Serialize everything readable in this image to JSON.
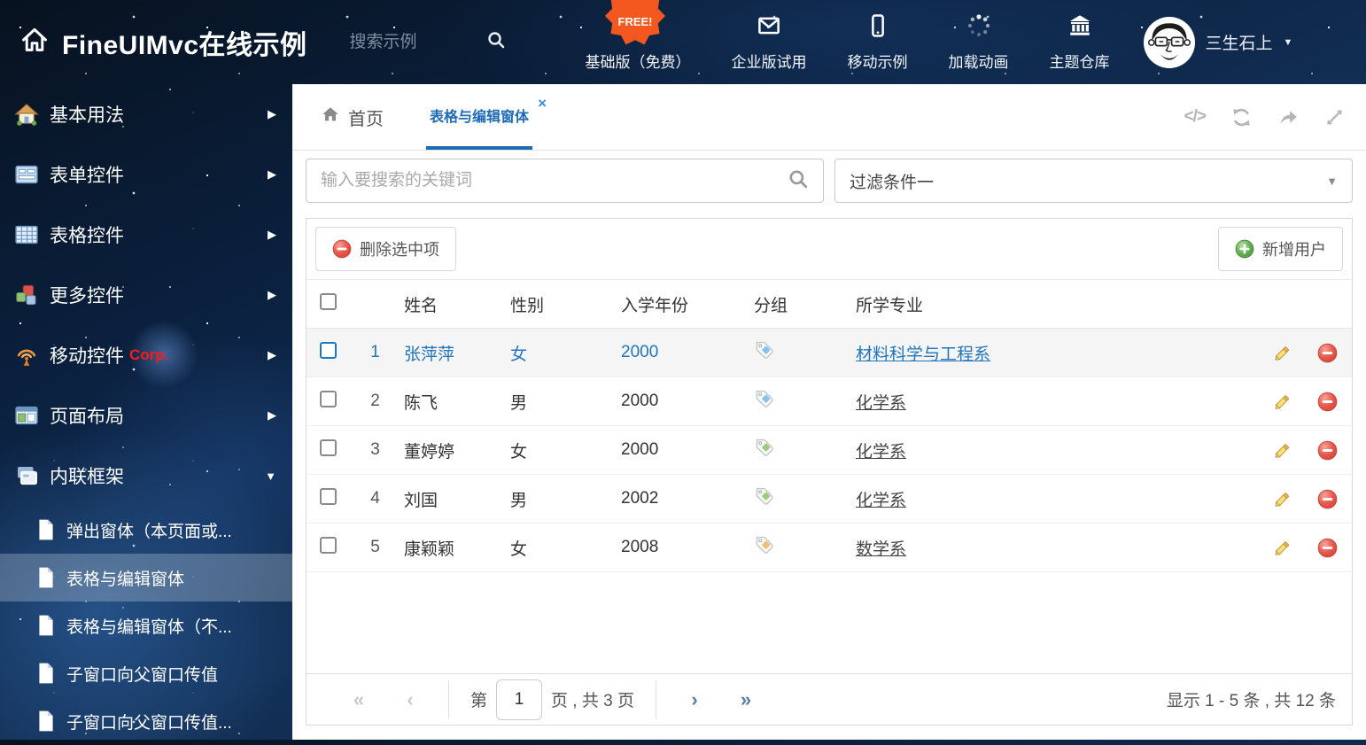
{
  "header": {
    "title": "FineUIMvc在线示例",
    "search_placeholder": "搜索示例",
    "free_badge": "FREE!",
    "nav": [
      {
        "label": "基础版（免费）",
        "icon": "download-icon"
      },
      {
        "label": "企业版试用",
        "icon": "envelope-icon"
      },
      {
        "label": "移动示例",
        "icon": "mobile-icon"
      },
      {
        "label": "加载动画",
        "icon": "spinner-icon"
      },
      {
        "label": "主题仓库",
        "icon": "bank-icon"
      }
    ],
    "user_name": "三生石上"
  },
  "sidebar": {
    "items": [
      {
        "label": "基本用法",
        "icon": "home-icon"
      },
      {
        "label": "表单控件",
        "icon": "form-icon"
      },
      {
        "label": "表格控件",
        "icon": "grid-icon"
      },
      {
        "label": "更多控件",
        "icon": "cubes-icon"
      },
      {
        "label": "移动控件",
        "icon": "antenna-icon",
        "badge": "Corp."
      },
      {
        "label": "页面布局",
        "icon": "layout-icon"
      },
      {
        "label": "内联框架",
        "icon": "frames-icon",
        "expanded": true
      }
    ],
    "subitems": [
      {
        "label": "弹出窗体（本页面或..."
      },
      {
        "label": "表格与编辑窗体",
        "selected": true
      },
      {
        "label": "表格与编辑窗体（不..."
      },
      {
        "label": "子窗口向父窗口传值"
      },
      {
        "label": "子窗口向父窗口传值..."
      }
    ]
  },
  "tabs": [
    {
      "label": "首页",
      "icon": "home-icon"
    },
    {
      "label": "表格与编辑窗体",
      "active": true,
      "closable": true
    }
  ],
  "filters": {
    "search_placeholder": "输入要搜索的关键词",
    "filter_value": "过滤条件一"
  },
  "toolbar": {
    "delete_label": "删除选中项",
    "add_label": "新增用户"
  },
  "table": {
    "columns": [
      "姓名",
      "性别",
      "入学年份",
      "分组",
      "所学专业"
    ],
    "rows": [
      {
        "index": "1",
        "name": "张萍萍",
        "gender": "女",
        "year": "2000",
        "tag_color": "#85c2ee",
        "major": "材料科学与工程系",
        "highlighted": true
      },
      {
        "index": "2",
        "name": "陈飞",
        "gender": "男",
        "year": "2000",
        "tag_color": "#85c2ee",
        "major": "化学系",
        "highlighted": false
      },
      {
        "index": "3",
        "name": "董婷婷",
        "gender": "女",
        "year": "2000",
        "tag_color": "#9ccb7e",
        "major": "化学系",
        "highlighted": false
      },
      {
        "index": "4",
        "name": "刘国",
        "gender": "男",
        "year": "2002",
        "tag_color": "#9ccb7e",
        "major": "化学系",
        "highlighted": false
      },
      {
        "index": "5",
        "name": "康颖颖",
        "gender": "女",
        "year": "2008",
        "tag_color": "#f8bb77",
        "major": "数学系",
        "highlighted": false
      }
    ]
  },
  "pagination": {
    "prefix": "第",
    "page_value": "1",
    "suffix": "页 , 共 3 页",
    "summary": "显示 1 - 5 条 , 共 12 条",
    "icons": {
      "first": "«",
      "prev": "‹",
      "next": "›",
      "last": "»"
    }
  },
  "icons": {
    "close_tab": "×",
    "caret_down": "▼",
    "arrow_right": "▶",
    "code": "</>"
  },
  "colors": {
    "accent_blue": "#1f6bb5",
    "delete_red": "#e0564a",
    "add_green": "#5cb151",
    "free_orange": "#f4581e"
  }
}
